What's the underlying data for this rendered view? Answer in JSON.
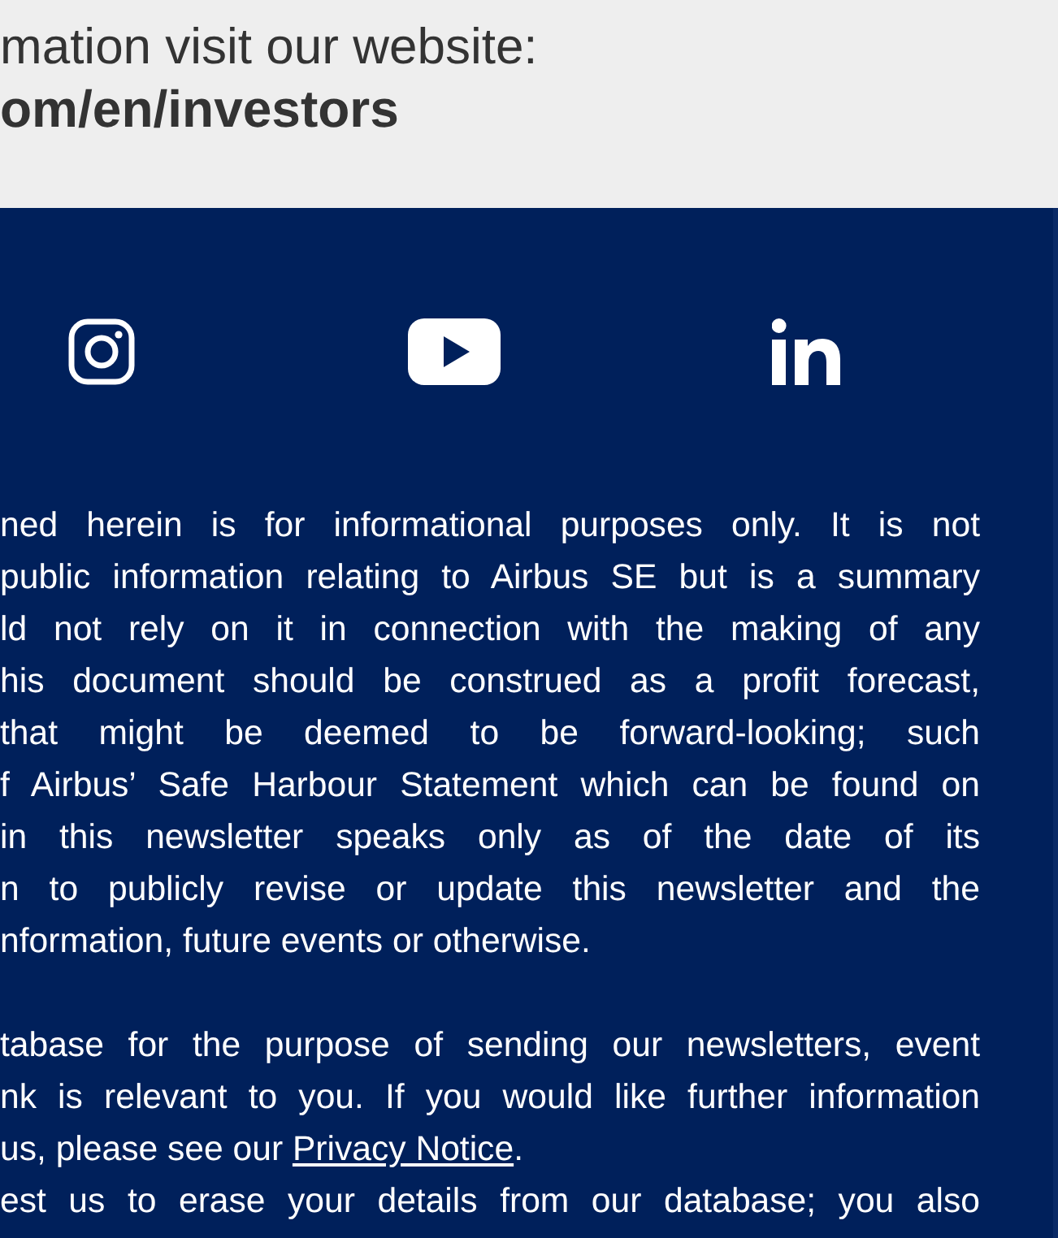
{
  "investor_banner": {
    "intro": "mation visit our website:",
    "website": "om/en/investors"
  },
  "social_links": [
    {
      "kind": "instagram"
    },
    {
      "kind": "youtube"
    },
    {
      "kind": "linkedin"
    }
  ],
  "disclaimer_paragraphs": [
    {
      "lines": [
        {
          "text": "ned herein is for informational purposes only. It is not",
          "justify": true
        },
        {
          "text": "public information relating to Airbus SE but is a summary",
          "justify": true
        },
        {
          "text": "ld not rely on it in connection with the making of any",
          "justify": true
        },
        {
          "text": "his document should be construed as a profit forecast,",
          "justify": true
        },
        {
          "text": "that might be deemed to be forward-looking; such",
          "justify": true
        },
        {
          "text": "f Airbus’ Safe Harbour Statement which can be found on",
          "justify": true
        },
        {
          "text": "in this newsletter speaks only as of the date of its",
          "justify": true
        },
        {
          "text": "n to publicly revise or update this newsletter and the",
          "justify": true
        },
        {
          "text": "nformation, future events or otherwise.",
          "justify": false
        }
      ]
    },
    {
      "lines": [
        {
          "text": "tabase for the purpose of sending our newsletters, event",
          "justify": true
        },
        {
          "text": "nk is relevant to you. If you would like further information",
          "justify": true
        },
        {
          "text": "us, please see our ",
          "link": "Privacy Notice",
          "after": ".",
          "justify": false
        },
        {
          "text": "est us to erase your details from our database; you also",
          "justify": true
        }
      ]
    }
  ]
}
